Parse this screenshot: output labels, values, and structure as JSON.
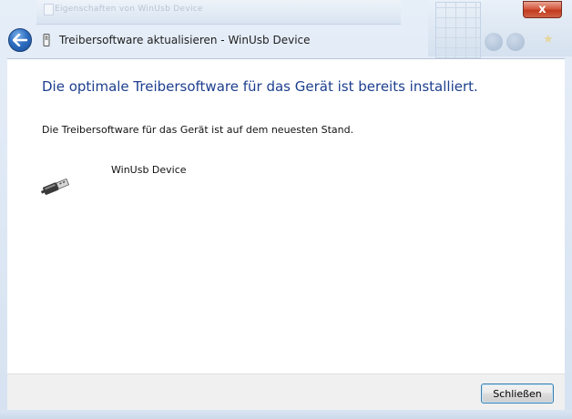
{
  "window": {
    "close_glyph": "x"
  },
  "header": {
    "title": "Treibersoftware aktualisieren - WinUsb Device",
    "back_icon": "back-arrow-icon",
    "device_icon": "usb-connector-icon"
  },
  "content": {
    "heading": "Die optimale Treibersoftware für das Gerät ist bereits installiert.",
    "description": "Die Treibersoftware für das Gerät ist auf dem neuesten Stand.",
    "device_name": "WinUsb Device",
    "device_icon": "usb-plug-icon"
  },
  "footer": {
    "close_button_label": "Schließen"
  },
  "background": {
    "blurred_title": "Eigenschaften von WinUsb Device"
  },
  "colors": {
    "heading": "#1d3f8f",
    "close_button": "#c13a1f",
    "back_button": "#2e6fc2"
  }
}
